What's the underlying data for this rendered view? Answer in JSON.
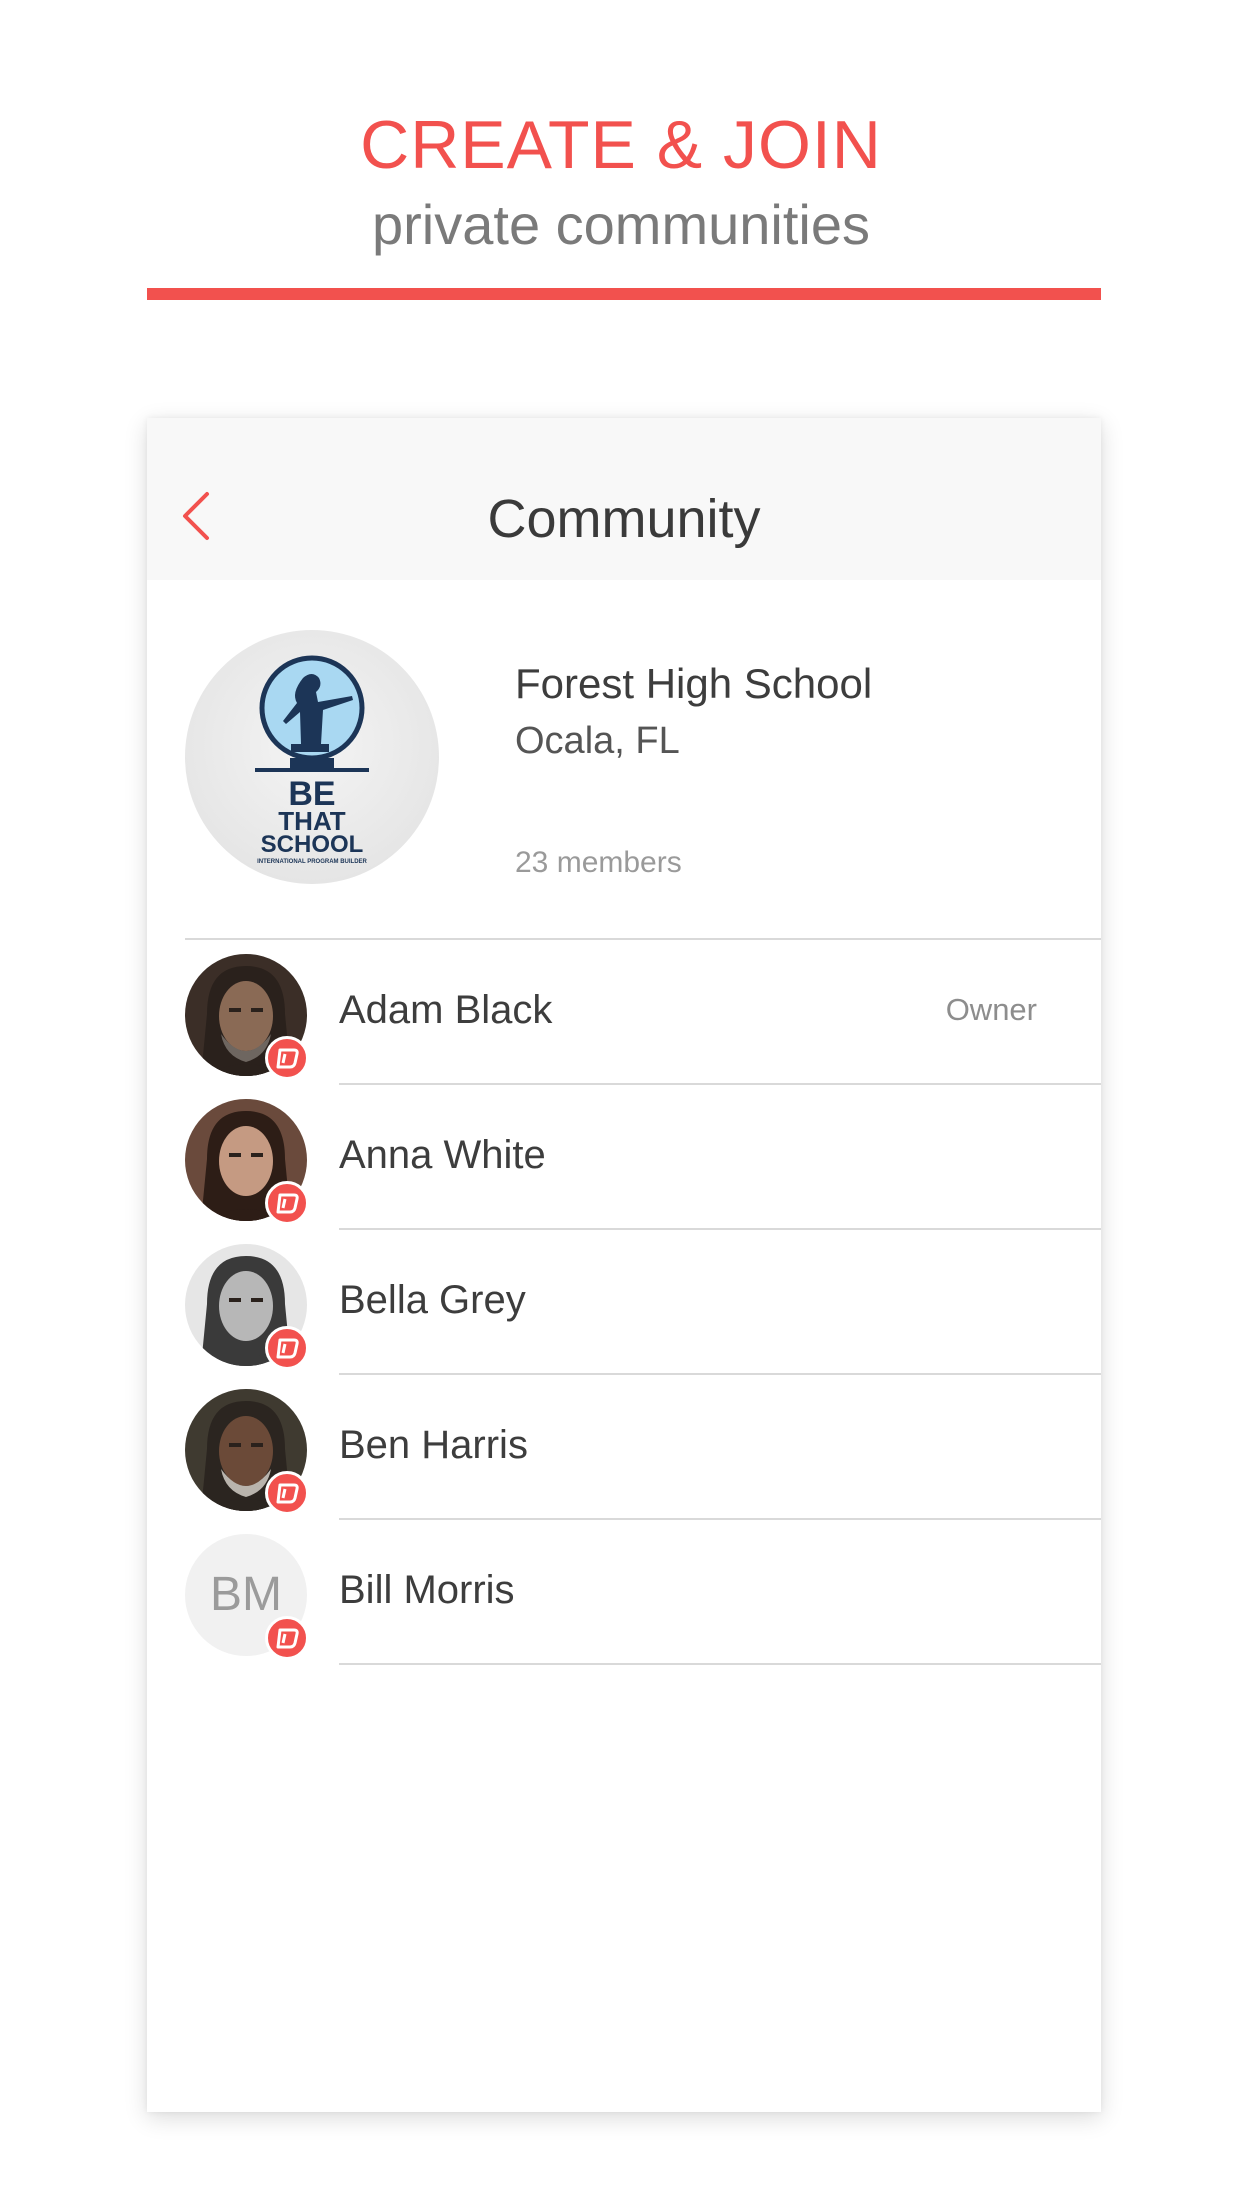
{
  "promo": {
    "heading": "CREATE & JOIN",
    "subheading": "private communities",
    "accent_color": "#f2514e"
  },
  "nav": {
    "title": "Community",
    "back_icon": "chevron-left-icon"
  },
  "community": {
    "name": "Forest High School",
    "location": "Ocala, FL",
    "members_count": "23 members",
    "logo_lines": [
      "BE",
      "THAT",
      "SCHOOL",
      "INTERNATIONAL PROGRAM BUILDER"
    ]
  },
  "members": [
    {
      "name": "Adam Black",
      "role": "Owner",
      "initials": "",
      "avatar_color": "#3b2e27"
    },
    {
      "name": "Anna White",
      "role": "",
      "initials": "",
      "avatar_color": "#6a4a3c"
    },
    {
      "name": "Bella Grey",
      "role": "",
      "initials": "",
      "avatar_color": "#8a8a8a"
    },
    {
      "name": "Ben Harris",
      "role": "",
      "initials": "",
      "avatar_color": "#3f3a30"
    },
    {
      "name": "Bill Morris",
      "role": "",
      "initials": "BM",
      "avatar_color": "#f1f1f1"
    }
  ]
}
